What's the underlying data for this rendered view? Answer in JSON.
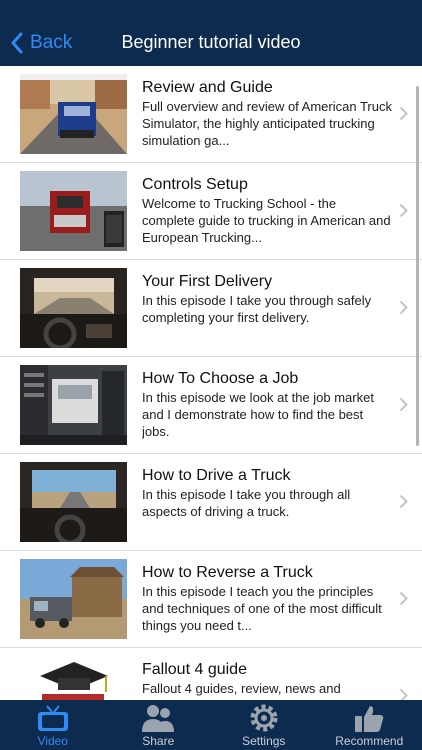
{
  "nav": {
    "back_label": "Back",
    "title": "Beginner tutorial video"
  },
  "videos": [
    {
      "title": "Review and Guide",
      "description": "Full overview and review of American Truck Simulator, the highly anticipated trucking simulation ga..."
    },
    {
      "title": "Controls Setup",
      "description": "Welcome to Trucking School - the complete guide to trucking in American and European Trucking..."
    },
    {
      "title": "Your First Delivery",
      "description": "In this episode I take you through safely completing your first delivery."
    },
    {
      "title": "How To Choose a Job",
      "description": "In this episode we look at the job market and I demonstrate how to find the best jobs."
    },
    {
      "title": "How to Drive a Truck",
      "description": "In this episode I take you through all aspects of driving a truck."
    },
    {
      "title": "How to Reverse a Truck",
      "description": "In this episode I teach you the principles and techniques of one of the most difficult things you need t..."
    },
    {
      "title": "Fallout 4 guide",
      "description": "Fallout 4 guides, review, news and"
    }
  ],
  "tabs": [
    {
      "label": "Video",
      "icon": "tv-icon"
    },
    {
      "label": "Share",
      "icon": "people-icon"
    },
    {
      "label": "Settings",
      "icon": "gear-icon"
    },
    {
      "label": "Recommend",
      "icon": "thumbs-up-icon"
    }
  ],
  "colors": {
    "navbar": "#0d2a4f",
    "accent": "#2f8cf5",
    "tab_inactive": "#c9cfd8"
  }
}
